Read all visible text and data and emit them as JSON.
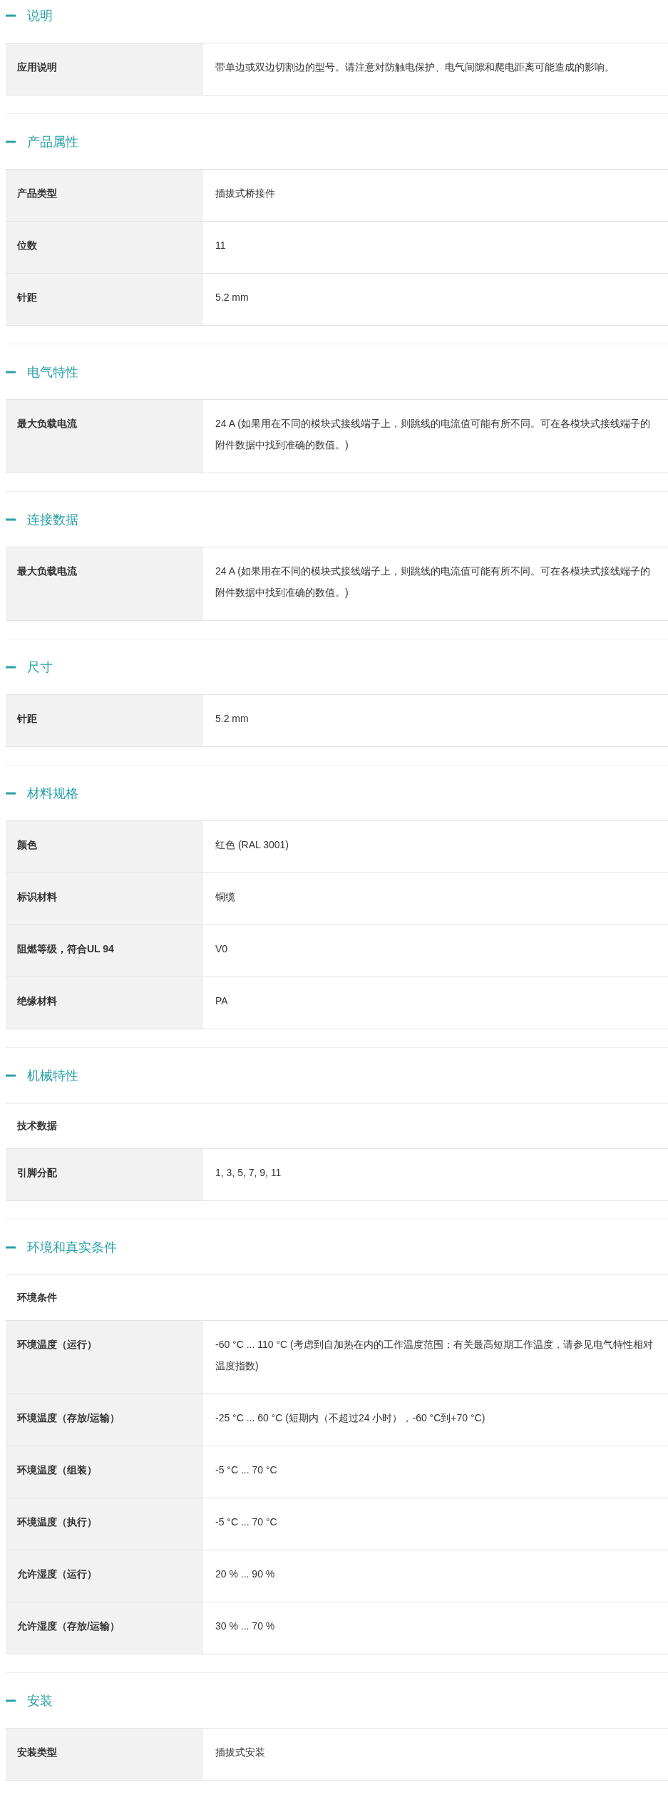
{
  "sections": [
    {
      "title": "说明",
      "expanded": true,
      "rows": [
        {
          "kind": "pair",
          "label": "应用说明",
          "value": "带单边或双边切割边的型号。请注意对防触电保护、电气间隙和爬电距离可能造成的影响。"
        }
      ]
    },
    {
      "title": "产品属性",
      "expanded": true,
      "rows": [
        {
          "kind": "pair",
          "label": "产品类型",
          "value": "插拔式桥接件"
        },
        {
          "kind": "pair",
          "label": "位数",
          "value": "11"
        },
        {
          "kind": "pair",
          "label": "针距",
          "value": "5.2 mm"
        }
      ]
    },
    {
      "title": "电气特性",
      "expanded": true,
      "rows": [
        {
          "kind": "pair",
          "label": "最大负载电流",
          "value": "24 A (如果用在不同的模块式接线端子上，则跳线的电流值可能有所不同。可在各模块式接线端子的附件数据中找到准确的数值。)"
        }
      ]
    },
    {
      "title": "连接数据",
      "expanded": true,
      "rows": [
        {
          "kind": "pair",
          "label": "最大负载电流",
          "value": "24 A (如果用在不同的模块式接线端子上，则跳线的电流值可能有所不同。可在各模块式接线端子的附件数据中找到准确的数值。)"
        }
      ]
    },
    {
      "title": "尺寸",
      "expanded": true,
      "rows": [
        {
          "kind": "pair",
          "label": "针距",
          "value": "5.2 mm"
        }
      ]
    },
    {
      "title": "材料规格",
      "expanded": true,
      "rows": [
        {
          "kind": "pair",
          "label": "颜色",
          "value": "红色 (RAL 3001)"
        },
        {
          "kind": "pair",
          "label": "标识材料",
          "value": "铜缆"
        },
        {
          "kind": "pair",
          "label": "阻燃等级，符合UL 94",
          "value": "V0"
        },
        {
          "kind": "pair",
          "label": "绝缘材料",
          "value": "PA"
        }
      ]
    },
    {
      "title": "机械特性",
      "expanded": true,
      "rows": [
        {
          "kind": "subheader",
          "label": "技术数据"
        },
        {
          "kind": "pair",
          "label": "引脚分配",
          "value": "1, 3, 5, 7, 9, 11"
        }
      ]
    },
    {
      "title": "环境和真实条件",
      "expanded": true,
      "rows": [
        {
          "kind": "subheader",
          "label": "环境条件"
        },
        {
          "kind": "pair",
          "label": "环境温度（运行）",
          "value": "-60 °C ... 110 °C (考虑到自加热在内的工作温度范围；有关最高短期工作温度，请参见电气特性相对温度指数)"
        },
        {
          "kind": "pair",
          "label": "环境温度（存放/运输）",
          "value": "-25 °C ... 60 °C (短期内（不超过24  小时），-60 °C到+70 °C)"
        },
        {
          "kind": "pair",
          "label": "环境温度（组装）",
          "value": "-5 °C ... 70 °C"
        },
        {
          "kind": "pair",
          "label": "环境温度（执行）",
          "value": "-5 °C ... 70 °C"
        },
        {
          "kind": "pair",
          "label": "允许湿度（运行）",
          "value": "20 % ... 90 %"
        },
        {
          "kind": "pair",
          "label": "允许湿度（存放/运输）",
          "value": "30 % ... 70 %"
        }
      ]
    },
    {
      "title": "安装",
      "expanded": true,
      "rows": [
        {
          "kind": "pair",
          "label": "安装类型",
          "value": "插拔式安装"
        }
      ]
    }
  ]
}
